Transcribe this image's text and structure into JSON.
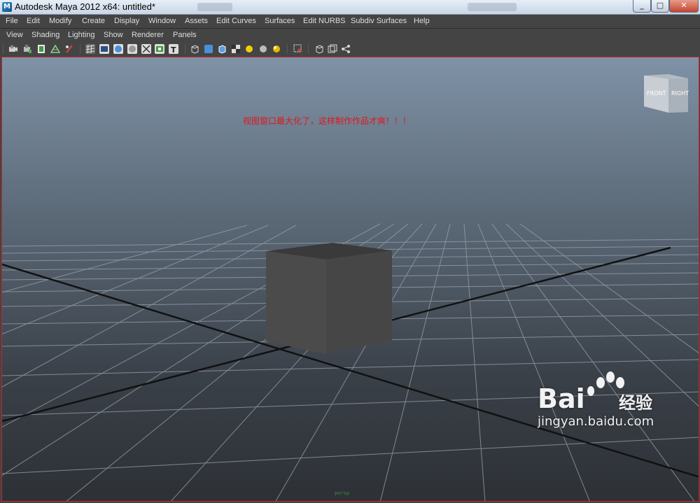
{
  "window": {
    "title": "Autodesk Maya 2012 x64: untitled*",
    "icon_letter": "M",
    "buttons": {
      "minimize": "_",
      "maximize": "□",
      "close": "✕"
    }
  },
  "menubar": [
    "File",
    "Edit",
    "Modify",
    "Create",
    "Display",
    "Window",
    "Assets",
    "Edit Curves",
    "Surfaces",
    "Edit NURBS",
    "Subdiv Surfaces",
    "Help"
  ],
  "panel_menu": [
    "View",
    "Shading",
    "Lighting",
    "Show",
    "Renderer",
    "Panels"
  ],
  "toolbar": {
    "icons": [
      "camera-attributes-icon",
      "bookmark-camera-icon",
      "image-plane-icon",
      "2d-pan-zoom-icon",
      "grease-pencil-icon",
      "grid-icon",
      "film-gate-icon",
      "resolution-gate-icon",
      "gate-mask-icon",
      "field-chart-icon",
      "safe-action-icon",
      "safe-title-icon",
      "wireframe-icon",
      "smooth-shade-icon",
      "wireframe-on-shaded-icon",
      "textured-icon",
      "default-lighting-icon",
      "shadows-icon",
      "all-lights-icon",
      "isolate-select-icon",
      "xray-icon",
      "xray-joints-icon",
      "xray-components-icon"
    ],
    "colors": {
      "wireframe": "#d9d9d9",
      "smooth": "#4a90d9",
      "light": "#f0d000",
      "shadow": "#bbbbbb"
    }
  },
  "viewport": {
    "annotation": "视图窗口最大化了，这样制作作品才爽！！！",
    "viewcube": {
      "front": "FRONT",
      "right": "RIGHT"
    },
    "border_color": "#c0262c",
    "bottom_label": "persp"
  },
  "watermark": {
    "brand": "Bai",
    "brand_cn": "经验",
    "url": "jingyan.baidu.com"
  }
}
